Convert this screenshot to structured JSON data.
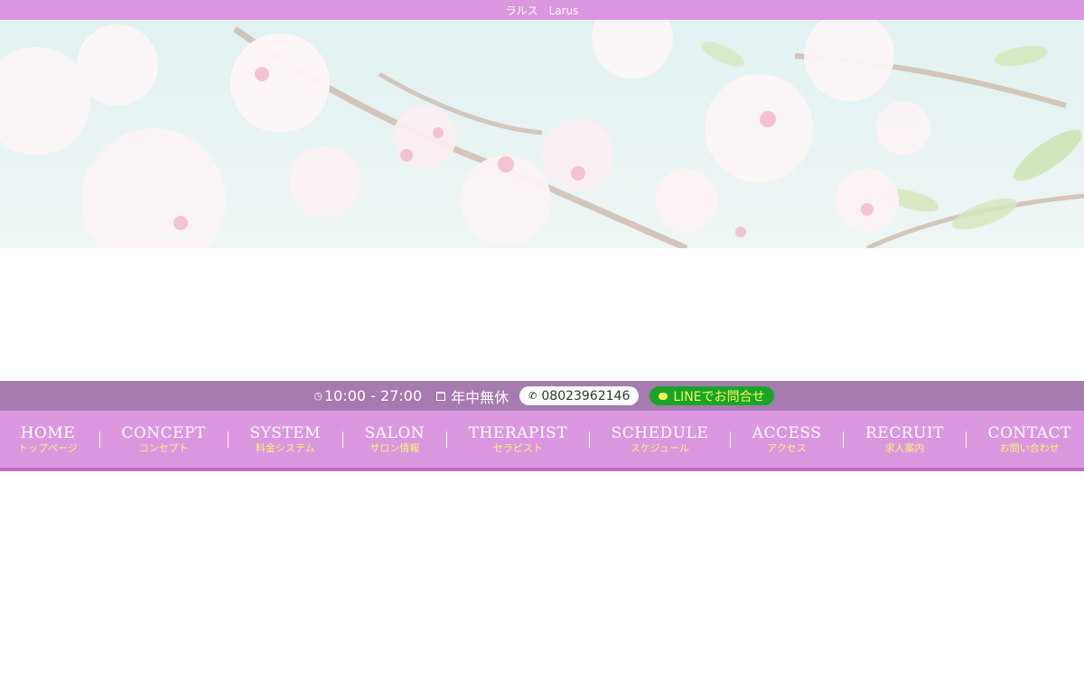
{
  "site": {
    "title": "ラルス　Larus"
  },
  "hero": {
    "image": "cherry-blossom-banner"
  },
  "info": {
    "hours": "10:00 - 27:00",
    "closed": "年中無休",
    "phone": "08023962146",
    "line_label": "LINEでお問合せ"
  },
  "nav": {
    "items": [
      {
        "en": "HOME",
        "jp": "トップページ"
      },
      {
        "en": "CONCEPT",
        "jp": "コンセプト"
      },
      {
        "en": "SYSTEM",
        "jp": "料金システム"
      },
      {
        "en": "SALON",
        "jp": "サロン情報"
      },
      {
        "en": "THERAPIST",
        "jp": "セラピスト"
      },
      {
        "en": "SCHEDULE",
        "jp": "スケジュール"
      },
      {
        "en": "ACCESS",
        "jp": "アクセス"
      },
      {
        "en": "RECRUIT",
        "jp": "求人案内"
      },
      {
        "en": "CONTACT",
        "jp": "お問い合わせ"
      }
    ]
  },
  "colors": {
    "topbar": "#dc97e1",
    "infobar": "#a57bb0",
    "nav_bg": "#dc97e1",
    "nav_border": "#c16cbf",
    "nav_sub_text": "#f7f36c",
    "line_green": "#1aa529",
    "line_text": "#f5f558"
  }
}
